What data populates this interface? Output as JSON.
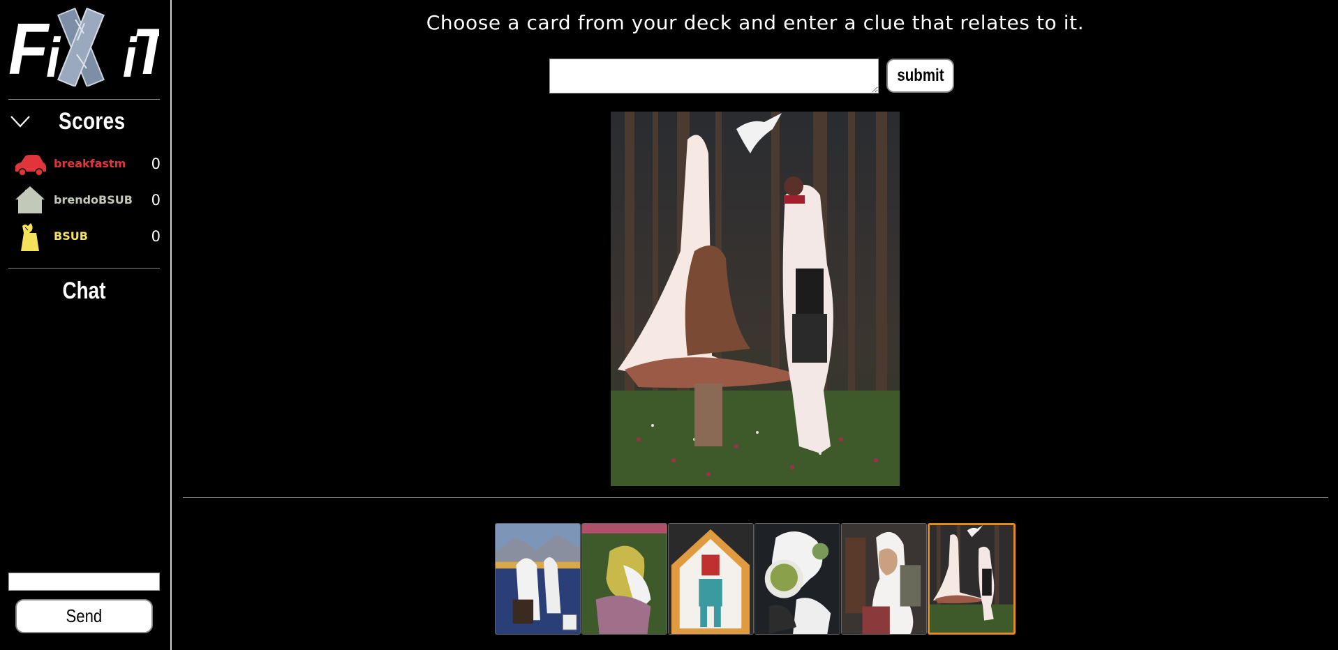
{
  "app": {
    "logo_text": "FiXiT"
  },
  "sidebar": {
    "scores_title": "Scores",
    "players": [
      {
        "name": "breakfastm",
        "score": "0",
        "color": "#e0353b",
        "icon": "car-icon"
      },
      {
        "name": "brendoBSUB",
        "score": "0",
        "color": "#c2c9b8",
        "icon": "house-icon"
      },
      {
        "name": "BSUB",
        "score": "0",
        "color": "#f5e25a",
        "icon": "bag-icon"
      }
    ],
    "chat_title": "Chat",
    "chat_input_value": "",
    "send_label": "Send"
  },
  "main": {
    "prompt": "Choose a card from your deck and enter a clue that relates to it.",
    "clue_value": "",
    "submit_label": "submit",
    "selected_card_index": 5,
    "hand_count": 6,
    "selected_border_color": "#e08a22"
  }
}
